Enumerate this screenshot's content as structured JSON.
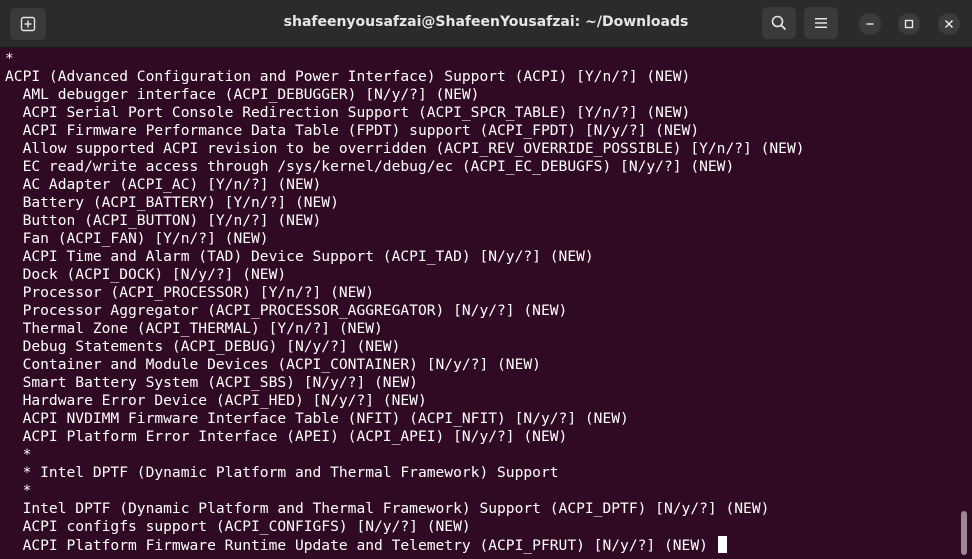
{
  "window": {
    "title": "shafeenyousafzai@ShafeenYousafzai: ~/Downloads"
  },
  "titlebar_icons": {
    "new_tab": "new-tab-icon",
    "search": "search-icon",
    "menu": "hamburger-menu-icon",
    "minimize": "minimize-icon",
    "maximize": "maximize-icon",
    "close": "close-icon"
  },
  "colors": {
    "terminal_background": "#300a24",
    "terminal_foreground": "#ffffff",
    "titlebar_background": "#2b2b2b"
  },
  "terminal": {
    "lines": [
      "*",
      "ACPI (Advanced Configuration and Power Interface) Support (ACPI) [Y/n/?] (NEW)",
      "  AML debugger interface (ACPI_DEBUGGER) [N/y/?] (NEW)",
      "  ACPI Serial Port Console Redirection Support (ACPI_SPCR_TABLE) [Y/n/?] (NEW)",
      "  ACPI Firmware Performance Data Table (FPDT) support (ACPI_FPDT) [N/y/?] (NEW)",
      "  Allow supported ACPI revision to be overridden (ACPI_REV_OVERRIDE_POSSIBLE) [Y/n/?] (NEW)",
      "  EC read/write access through /sys/kernel/debug/ec (ACPI_EC_DEBUGFS) [N/y/?] (NEW)",
      "  AC Adapter (ACPI_AC) [Y/n/?] (NEW)",
      "  Battery (ACPI_BATTERY) [Y/n/?] (NEW)",
      "  Button (ACPI_BUTTON) [Y/n/?] (NEW)",
      "  Fan (ACPI_FAN) [Y/n/?] (NEW)",
      "  ACPI Time and Alarm (TAD) Device Support (ACPI_TAD) [N/y/?] (NEW)",
      "  Dock (ACPI_DOCK) [N/y/?] (NEW)",
      "  Processor (ACPI_PROCESSOR) [Y/n/?] (NEW)",
      "  Processor Aggregator (ACPI_PROCESSOR_AGGREGATOR) [N/y/?] (NEW)",
      "  Thermal Zone (ACPI_THERMAL) [Y/n/?] (NEW)",
      "  Debug Statements (ACPI_DEBUG) [N/y/?] (NEW)",
      "  Container and Module Devices (ACPI_CONTAINER) [N/y/?] (NEW)",
      "  Smart Battery System (ACPI_SBS) [N/y/?] (NEW)",
      "  Hardware Error Device (ACPI_HED) [N/y/?] (NEW)",
      "  ACPI NVDIMM Firmware Interface Table (NFIT) (ACPI_NFIT) [N/y/?] (NEW)",
      "  ACPI Platform Error Interface (APEI) (ACPI_APEI) [N/y/?] (NEW)",
      "  *",
      "  * Intel DPTF (Dynamic Platform and Thermal Framework) Support",
      "  *",
      "  Intel DPTF (Dynamic Platform and Thermal Framework) Support (ACPI_DPTF) [N/y/?] (NEW)",
      "  ACPI configfs support (ACPI_CONFIGFS) [N/y/?] (NEW)",
      "  ACPI Platform Firmware Runtime Update and Telemetry (ACPI_PFRUT) [N/y/?] (NEW) "
    ]
  }
}
